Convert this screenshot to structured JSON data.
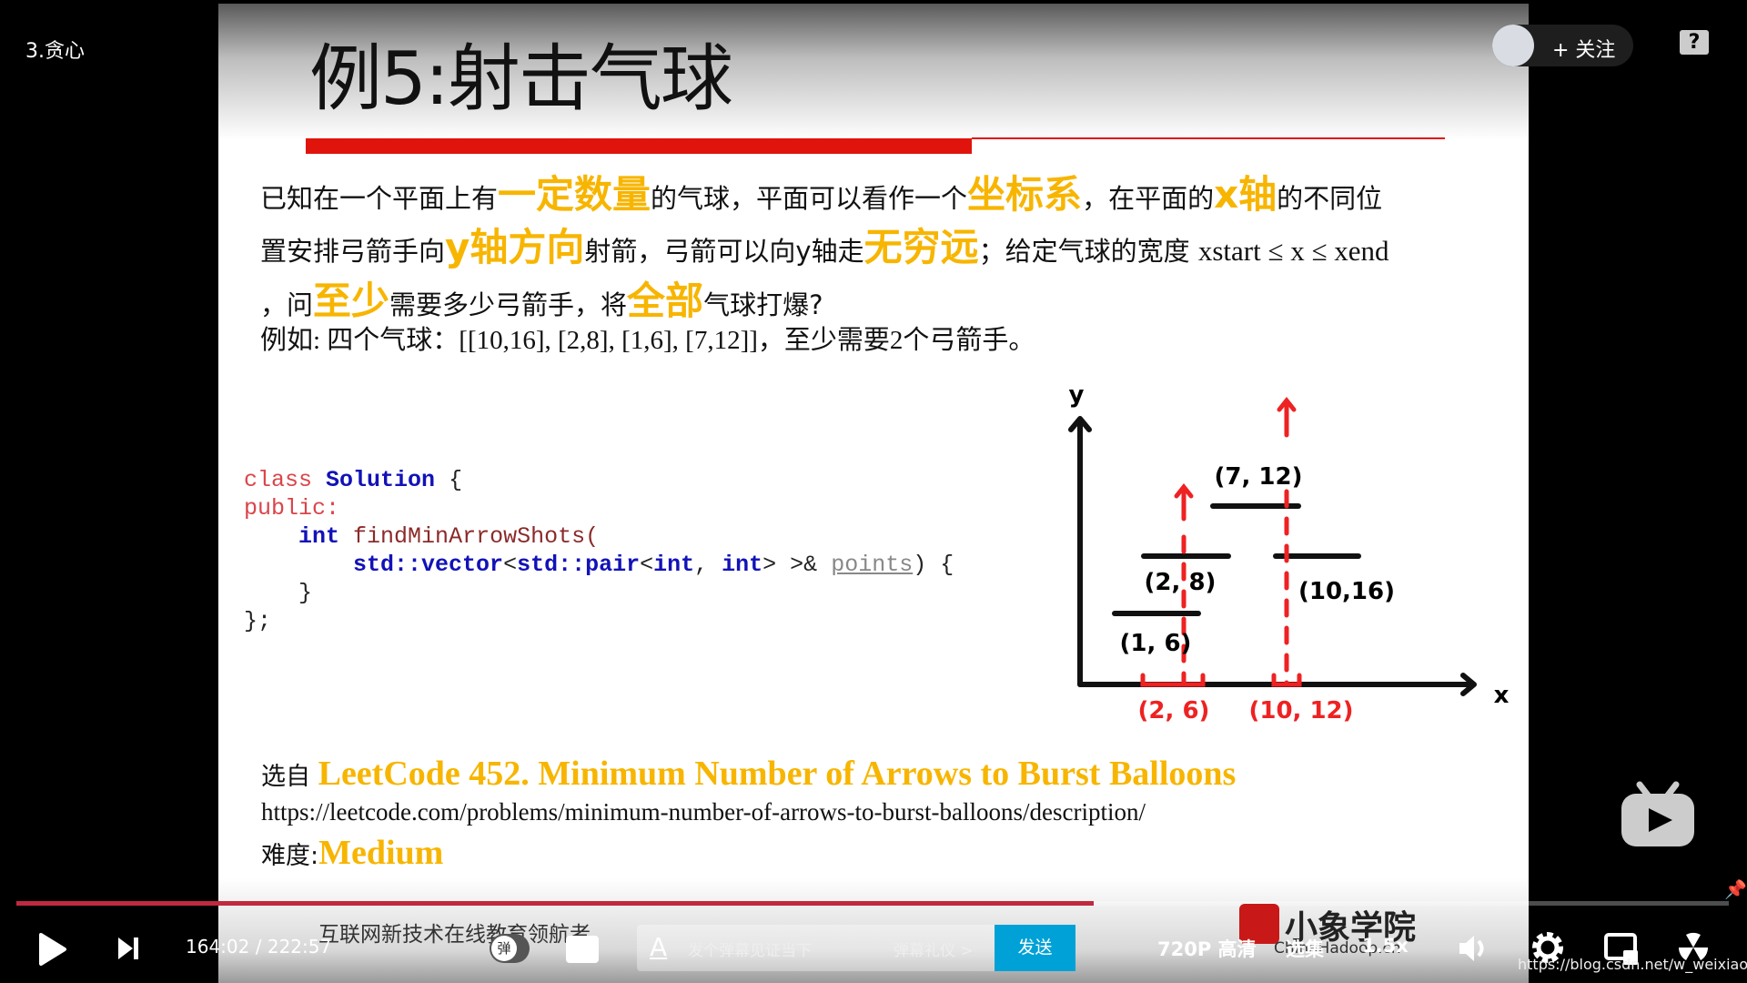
{
  "video": {
    "episode_title": "3.贪心",
    "follow_label": "+ 关注",
    "help_icon": "question-bubble-icon"
  },
  "slide": {
    "title": "例5:射击气球",
    "line1": [
      "已知在一个平面上有",
      "一定数量",
      "的气球，平面可以看作一个",
      "坐标系",
      "，在平面的",
      "x轴",
      "的不同位"
    ],
    "line2": [
      "置安排弓箭手向",
      "y轴方向",
      "射箭，弓箭可以向y轴走",
      "无穷远",
      "；给定气球的宽度 ",
      "xstart ≤ x ≤ xend"
    ],
    "line3": [
      "，问",
      "至少",
      "需要多少弓箭手，将",
      "全部",
      "气球打爆?"
    ],
    "line4": "例如: 四个气球：[[10,16], [2,8], [1,6], [7,12]]，至少需要2个弓箭手。",
    "code": {
      "l1a": "class",
      "l1b": "Solution",
      "l1c": " {",
      "l2": "public:",
      "l3a": "int",
      "l3b": "findMinArrowShots(",
      "l4a": "std::vector",
      "l4b": "<",
      "l4c": "std::pair",
      "l4d": "<",
      "l4e": "int",
      "l4f": ", ",
      "l4g": "int",
      "l4h": "> >& ",
      "l4i": "points",
      "l4j": ") {",
      "l5": "}",
      "l6": "};"
    },
    "diagram": {
      "y_label": "y",
      "x_label": "x",
      "balloons": [
        "(1, 6)",
        "(2, 8)",
        "(7, 12)",
        "(10,16)"
      ],
      "overlaps": [
        "(2, 6)",
        "(10, 12)"
      ]
    },
    "source_prefix": "选自",
    "source_title": "LeetCode 452. Minimum Number of Arrows to Burst Balloons",
    "url": "https://leetcode.com/problems/minimum-number-of-arrows-to-burst-balloons/description/",
    "difficulty_label": "难度:",
    "difficulty": "Medium",
    "footer_slogan": "互联网新技术在线教育领航者",
    "logo_text": "小象学院",
    "logo_sub": "ChinaHadoop.cn"
  },
  "player": {
    "time_current": "164:02",
    "time_sep": "/",
    "time_total": "222:57",
    "progress_fraction": 0.737,
    "danmaku_toggle": "弹",
    "danmaku_placeholder": "发个弹幕见证当下",
    "danmaku_etiquette": "弹幕礼仪 >",
    "send_label": "发送",
    "quality": "720P 高清",
    "episodes": "选集",
    "speed": "1.5x",
    "watermark": "https://blog.csdn.net/w_weixiaotao",
    "accent": "#00a1d6",
    "progress_color": "#c0293f"
  }
}
